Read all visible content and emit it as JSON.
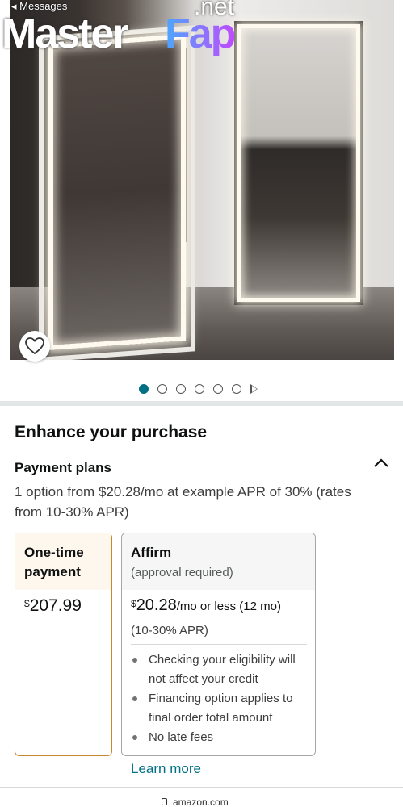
{
  "status": {
    "back_label": "◂ Messages"
  },
  "watermark": {
    "part1": "Master",
    "part2": "Fap",
    "suffix": ".net"
  },
  "product_image": {
    "alt_icon": "heart-icon"
  },
  "carousel": {
    "count": 6,
    "active_index": 0
  },
  "enhance": {
    "title": "Enhance your purchase",
    "plans_title": "Payment plans",
    "plans_description": "1 option from $20.28/mo at example APR of 30% (rates from 10-30% APR)"
  },
  "one_time": {
    "title": "One-time payment",
    "currency": "$",
    "price": "207.99"
  },
  "affirm": {
    "title": "Affirm",
    "subtitle": "(approval required)",
    "currency": "$",
    "price": "20.28",
    "price_suffix": "/mo or less (12 mo)",
    "apr": "(10-30% APR)",
    "bullets": [
      "Checking your eligibility will not affect your credit",
      "Financing option applies to final order total amount",
      "No late fees"
    ]
  },
  "learn_more": "Learn more",
  "bottom_bar": {
    "url": "amazon.com"
  },
  "colors": {
    "link": "#007185",
    "selected_border": "#c7872d",
    "active_dot": "#007185"
  }
}
